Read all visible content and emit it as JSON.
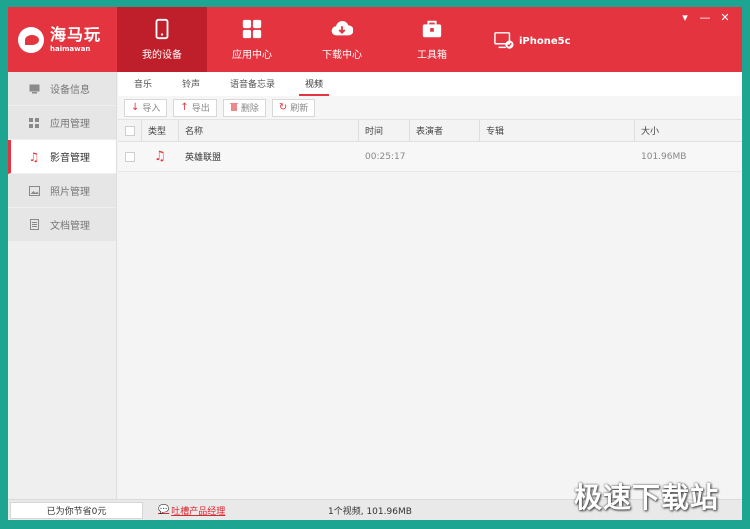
{
  "app": {
    "logo_cn": "海马玩",
    "logo_en": "haimawan"
  },
  "nav": [
    {
      "label": "我的设备",
      "icon": "phone-icon"
    },
    {
      "label": "应用中心",
      "icon": "grid-icon"
    },
    {
      "label": "下载中心",
      "icon": "cloud-download-icon"
    },
    {
      "label": "工具箱",
      "icon": "toolbox-icon"
    }
  ],
  "device": {
    "name": "iPhone5c"
  },
  "window_controls": {
    "menu": "▾",
    "minimize": "—",
    "close": "✕"
  },
  "sidebar": [
    {
      "label": "设备信息",
      "icon": "monitor-icon"
    },
    {
      "label": "应用管理",
      "icon": "apps-icon"
    },
    {
      "label": "影音管理",
      "icon": "music-note-icon"
    },
    {
      "label": "照片管理",
      "icon": "photo-icon"
    },
    {
      "label": "文档管理",
      "icon": "document-icon"
    }
  ],
  "tabs": [
    "音乐",
    "铃声",
    "语音备忘录",
    "视频"
  ],
  "toolbar": {
    "import": "导入",
    "export": "导出",
    "delete": "删除",
    "refresh": "刷新"
  },
  "table": {
    "headers": {
      "type": "类型",
      "name": "名称",
      "time": "时间",
      "artist": "表演者",
      "album": "专辑",
      "size": "大小"
    },
    "rows": [
      {
        "name": "英雄联盟",
        "time": "00:25:17",
        "artist": "",
        "album": "",
        "size": "101.96MB"
      }
    ]
  },
  "status": {
    "saved": "已为你节省0元",
    "feedback": "吐槽产品经理",
    "summary": "1个视频, 101.96MB"
  },
  "watermark": "极速下载站",
  "colors": {
    "accent": "#e3343f",
    "accent_dark": "#bf1f2a",
    "frame": "#1ea592"
  }
}
